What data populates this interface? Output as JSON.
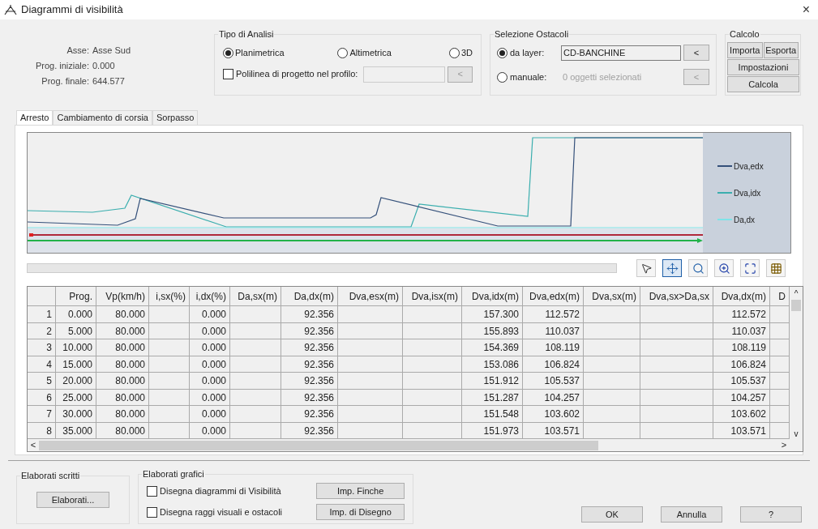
{
  "window": {
    "title": "Diagrammi di visibilità",
    "close": "×"
  },
  "info": [
    {
      "label": "Asse:",
      "value": "Asse Sud"
    },
    {
      "label": "Prog. iniziale:",
      "value": "0.000"
    },
    {
      "label": "Prog. finale:",
      "value": "644.577"
    }
  ],
  "analysis": {
    "title": "Tipo di Analisi",
    "options": [
      {
        "label": "Planimetrica",
        "selected": true
      },
      {
        "label": "Altimetrica",
        "selected": false
      },
      {
        "label": "3D",
        "selected": false
      }
    ],
    "polyline": {
      "label": "Polilinea di progetto nel profilo:",
      "checked": false,
      "pick": "<"
    }
  },
  "obstacles": {
    "title": "Selezione Ostacoli",
    "options": [
      {
        "label": "da layer:",
        "selected": true,
        "value": "CD-BANCHINE",
        "pick": "<"
      },
      {
        "label": "manuale:",
        "selected": false,
        "value": "0 oggetti selezionati",
        "pick": "<"
      }
    ]
  },
  "calc": {
    "title": "Calcolo",
    "buttons": [
      "Importa",
      "Esporta",
      "Impostazioni",
      "Calcola"
    ]
  },
  "tabs": [
    {
      "label": "Arresto",
      "selected": true
    },
    {
      "label": "Cambiamento di corsia",
      "selected": false
    },
    {
      "label": "Sorpasso",
      "selected": false
    }
  ],
  "legend": [
    {
      "name": "Dva,edx",
      "color": "#34507a"
    },
    {
      "name": "Dva,idx",
      "color": "#3aaeae"
    },
    {
      "name": "Da,dx",
      "color": "#7fe3e8"
    }
  ],
  "tools": [
    {
      "kind": "pointer",
      "selected": false
    },
    {
      "kind": "pan",
      "selected": true
    },
    {
      "kind": "zoom-window",
      "selected": false
    },
    {
      "kind": "zoom-in",
      "selected": false
    },
    {
      "kind": "zoom-extents",
      "selected": false
    },
    {
      "kind": "grid",
      "selected": false
    }
  ],
  "table": {
    "columns": [
      "",
      "Prog.",
      "Vp(km/h)",
      "i,sx(%)",
      "i,dx(%)",
      "Da,sx(m)",
      "Da,dx(m)",
      "Dva,esx(m)",
      "Dva,isx(m)",
      "Dva,idx(m)",
      "Dva,edx(m)",
      "Dva,sx(m)",
      "Dva,sx>Da,sx",
      "Dva,dx(m)",
      "D"
    ],
    "rows": [
      [
        "1",
        "0.000",
        "80.000",
        null,
        "0.000",
        null,
        "92.356",
        null,
        null,
        "157.300",
        "112.572",
        null,
        null,
        "112.572",
        null
      ],
      [
        "2",
        "5.000",
        "80.000",
        null,
        "0.000",
        null,
        "92.356",
        null,
        null,
        "155.893",
        "110.037",
        null,
        null,
        "110.037",
        null
      ],
      [
        "3",
        "10.000",
        "80.000",
        null,
        "0.000",
        null,
        "92.356",
        null,
        null,
        "154.369",
        "108.119",
        null,
        null,
        "108.119",
        null
      ],
      [
        "4",
        "15.000",
        "80.000",
        null,
        "0.000",
        null,
        "92.356",
        null,
        null,
        "153.086",
        "106.824",
        null,
        null,
        "106.824",
        null
      ],
      [
        "5",
        "20.000",
        "80.000",
        null,
        "0.000",
        null,
        "92.356",
        null,
        null,
        "151.912",
        "105.537",
        null,
        null,
        "105.537",
        null
      ],
      [
        "6",
        "25.000",
        "80.000",
        null,
        "0.000",
        null,
        "92.356",
        null,
        null,
        "151.287",
        "104.257",
        null,
        null,
        "104.257",
        null
      ],
      [
        "7",
        "30.000",
        "80.000",
        null,
        "0.000",
        null,
        "92.356",
        null,
        null,
        "151.548",
        "103.602",
        null,
        null,
        "103.602",
        null
      ],
      [
        "8",
        "35.000",
        "80.000",
        null,
        "0.000",
        null,
        "92.356",
        null,
        null,
        "151.973",
        "103.571",
        null,
        null,
        "103.571",
        null
      ]
    ],
    "scroll_left": "<",
    "scroll_right": ">",
    "scroll_up": "^",
    "scroll_down": "v"
  },
  "written": {
    "title": "Elaborati scritti",
    "button": "Elaborati..."
  },
  "graphic": {
    "title": "Elaborati grafici",
    "checks": [
      {
        "label": "Disegna diagrammi di Visibilità",
        "checked": false,
        "button": "Imp. Finche"
      },
      {
        "label": "Disegna raggi visuali e ostacoli",
        "checked": false,
        "button": "Imp. di Disegno"
      }
    ]
  },
  "footer": [
    "OK",
    "Annulla",
    "?"
  ]
}
